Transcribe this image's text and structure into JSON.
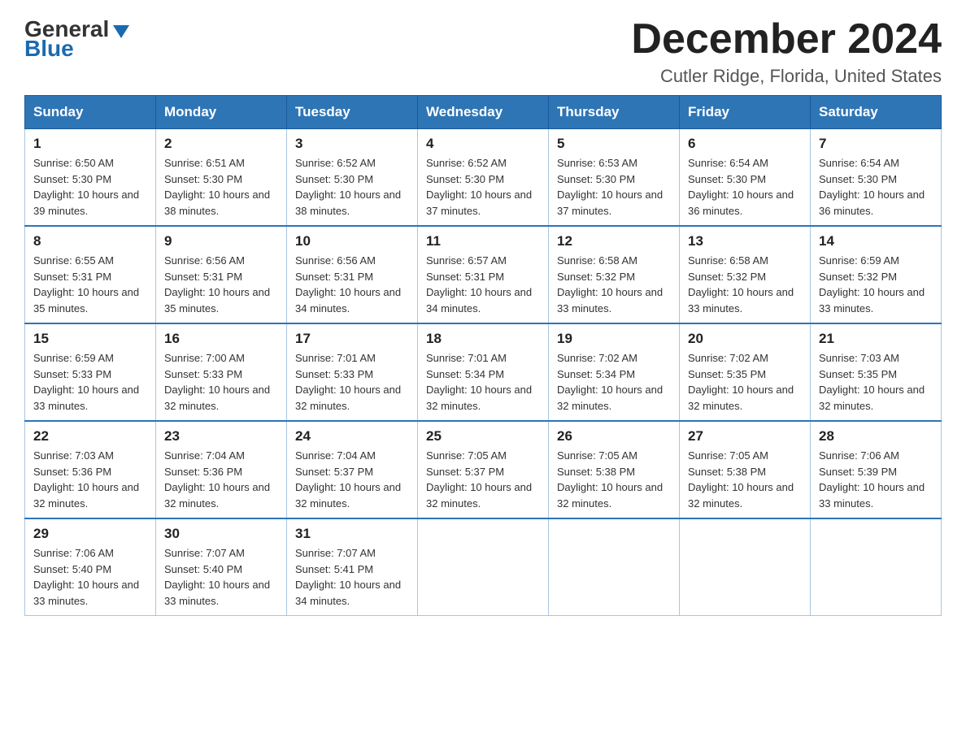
{
  "logo": {
    "general": "General",
    "blue": "Blue"
  },
  "title": {
    "month": "December 2024",
    "location": "Cutler Ridge, Florida, United States"
  },
  "headers": [
    "Sunday",
    "Monday",
    "Tuesday",
    "Wednesday",
    "Thursday",
    "Friday",
    "Saturday"
  ],
  "weeks": [
    [
      {
        "day": "1",
        "sunrise": "6:50 AM",
        "sunset": "5:30 PM",
        "daylight": "10 hours and 39 minutes."
      },
      {
        "day": "2",
        "sunrise": "6:51 AM",
        "sunset": "5:30 PM",
        "daylight": "10 hours and 38 minutes."
      },
      {
        "day": "3",
        "sunrise": "6:52 AM",
        "sunset": "5:30 PM",
        "daylight": "10 hours and 38 minutes."
      },
      {
        "day": "4",
        "sunrise": "6:52 AM",
        "sunset": "5:30 PM",
        "daylight": "10 hours and 37 minutes."
      },
      {
        "day": "5",
        "sunrise": "6:53 AM",
        "sunset": "5:30 PM",
        "daylight": "10 hours and 37 minutes."
      },
      {
        "day": "6",
        "sunrise": "6:54 AM",
        "sunset": "5:30 PM",
        "daylight": "10 hours and 36 minutes."
      },
      {
        "day": "7",
        "sunrise": "6:54 AM",
        "sunset": "5:30 PM",
        "daylight": "10 hours and 36 minutes."
      }
    ],
    [
      {
        "day": "8",
        "sunrise": "6:55 AM",
        "sunset": "5:31 PM",
        "daylight": "10 hours and 35 minutes."
      },
      {
        "day": "9",
        "sunrise": "6:56 AM",
        "sunset": "5:31 PM",
        "daylight": "10 hours and 35 minutes."
      },
      {
        "day": "10",
        "sunrise": "6:56 AM",
        "sunset": "5:31 PM",
        "daylight": "10 hours and 34 minutes."
      },
      {
        "day": "11",
        "sunrise": "6:57 AM",
        "sunset": "5:31 PM",
        "daylight": "10 hours and 34 minutes."
      },
      {
        "day": "12",
        "sunrise": "6:58 AM",
        "sunset": "5:32 PM",
        "daylight": "10 hours and 33 minutes."
      },
      {
        "day": "13",
        "sunrise": "6:58 AM",
        "sunset": "5:32 PM",
        "daylight": "10 hours and 33 minutes."
      },
      {
        "day": "14",
        "sunrise": "6:59 AM",
        "sunset": "5:32 PM",
        "daylight": "10 hours and 33 minutes."
      }
    ],
    [
      {
        "day": "15",
        "sunrise": "6:59 AM",
        "sunset": "5:33 PM",
        "daylight": "10 hours and 33 minutes."
      },
      {
        "day": "16",
        "sunrise": "7:00 AM",
        "sunset": "5:33 PM",
        "daylight": "10 hours and 32 minutes."
      },
      {
        "day": "17",
        "sunrise": "7:01 AM",
        "sunset": "5:33 PM",
        "daylight": "10 hours and 32 minutes."
      },
      {
        "day": "18",
        "sunrise": "7:01 AM",
        "sunset": "5:34 PM",
        "daylight": "10 hours and 32 minutes."
      },
      {
        "day": "19",
        "sunrise": "7:02 AM",
        "sunset": "5:34 PM",
        "daylight": "10 hours and 32 minutes."
      },
      {
        "day": "20",
        "sunrise": "7:02 AM",
        "sunset": "5:35 PM",
        "daylight": "10 hours and 32 minutes."
      },
      {
        "day": "21",
        "sunrise": "7:03 AM",
        "sunset": "5:35 PM",
        "daylight": "10 hours and 32 minutes."
      }
    ],
    [
      {
        "day": "22",
        "sunrise": "7:03 AM",
        "sunset": "5:36 PM",
        "daylight": "10 hours and 32 minutes."
      },
      {
        "day": "23",
        "sunrise": "7:04 AM",
        "sunset": "5:36 PM",
        "daylight": "10 hours and 32 minutes."
      },
      {
        "day": "24",
        "sunrise": "7:04 AM",
        "sunset": "5:37 PM",
        "daylight": "10 hours and 32 minutes."
      },
      {
        "day": "25",
        "sunrise": "7:05 AM",
        "sunset": "5:37 PM",
        "daylight": "10 hours and 32 minutes."
      },
      {
        "day": "26",
        "sunrise": "7:05 AM",
        "sunset": "5:38 PM",
        "daylight": "10 hours and 32 minutes."
      },
      {
        "day": "27",
        "sunrise": "7:05 AM",
        "sunset": "5:38 PM",
        "daylight": "10 hours and 32 minutes."
      },
      {
        "day": "28",
        "sunrise": "7:06 AM",
        "sunset": "5:39 PM",
        "daylight": "10 hours and 33 minutes."
      }
    ],
    [
      {
        "day": "29",
        "sunrise": "7:06 AM",
        "sunset": "5:40 PM",
        "daylight": "10 hours and 33 minutes."
      },
      {
        "day": "30",
        "sunrise": "7:07 AM",
        "sunset": "5:40 PM",
        "daylight": "10 hours and 33 minutes."
      },
      {
        "day": "31",
        "sunrise": "7:07 AM",
        "sunset": "5:41 PM",
        "daylight": "10 hours and 34 minutes."
      },
      null,
      null,
      null,
      null
    ]
  ]
}
